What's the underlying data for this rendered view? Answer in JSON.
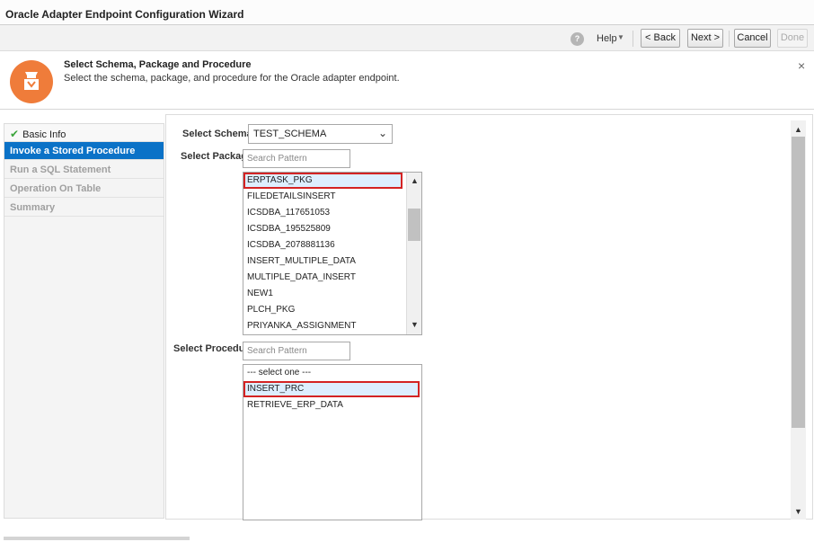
{
  "window": {
    "title": "Oracle Adapter Endpoint Configuration Wizard"
  },
  "toolbar": {
    "help_icon": "help-icon",
    "help_label": "Help",
    "back_label": "< Back",
    "next_label": "Next >",
    "cancel_label": "Cancel",
    "done_label": "Done"
  },
  "header": {
    "icon": "database-adapter-icon",
    "title": "Select Schema, Package and Procedure",
    "subtitle": "Select the schema, package, and procedure for the Oracle adapter endpoint.",
    "close_glyph": "×"
  },
  "sidebar": {
    "items": [
      {
        "label": "Basic Info",
        "state": "done"
      },
      {
        "label": "Invoke a Stored Procedure",
        "state": "active"
      },
      {
        "label": "Run a SQL Statement",
        "state": "disabled"
      },
      {
        "label": "Operation On Table",
        "state": "disabled"
      },
      {
        "label": "Summary",
        "state": "disabled"
      }
    ]
  },
  "form": {
    "schema_label": "Select Schema",
    "schema_value": "TEST_SCHEMA",
    "package_label": "Select Package",
    "package_placeholder": "Search Pattern",
    "packages": [
      "ERPTASK_PKG",
      "FILEDETAILSINSERT",
      "ICSDBA_117651053",
      "ICSDBA_195525809",
      "ICSDBA_2078881136",
      "INSERT_MULTIPLE_DATA",
      "MULTIPLE_DATA_INSERT",
      "NEW1",
      "PLCH_PKG",
      "PRIYANKA_ASSIGNMENT"
    ],
    "selected_package": "ERPTASK_PKG",
    "procedure_label": "Select Procedure",
    "procedure_placeholder": "Search Pattern",
    "procedures": [
      "--- select one ---",
      "INSERT_PRC",
      "RETRIEVE_ERP_DATA"
    ],
    "selected_procedure": "INSERT_PRC"
  },
  "colors": {
    "accent": "#0b72c7",
    "header_icon": "#ef7c3a",
    "highlight_border": "#d42323",
    "check": "#3aa43a"
  }
}
